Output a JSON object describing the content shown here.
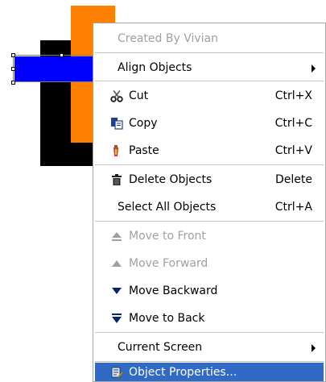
{
  "menu": {
    "items": [
      {
        "label": "Created By Vivian",
        "shortcut": "",
        "icon": "",
        "disabled": true,
        "submenu": false,
        "highlighted": false
      },
      {
        "label": "Align Objects",
        "shortcut": "",
        "icon": "",
        "disabled": false,
        "submenu": true,
        "highlighted": false
      },
      {
        "label": "Cut",
        "shortcut": "Ctrl+X",
        "icon": "scissors-icon",
        "disabled": false,
        "submenu": false,
        "highlighted": false
      },
      {
        "label": "Copy",
        "shortcut": "Ctrl+C",
        "icon": "copy-icon",
        "disabled": false,
        "submenu": false,
        "highlighted": false
      },
      {
        "label": "Paste",
        "shortcut": "Ctrl+V",
        "icon": "paste-icon",
        "disabled": false,
        "submenu": false,
        "highlighted": false
      },
      {
        "label": "Delete Objects",
        "shortcut": "Delete",
        "icon": "trash-icon",
        "disabled": false,
        "submenu": false,
        "highlighted": false
      },
      {
        "label": "Select All Objects",
        "shortcut": "Ctrl+A",
        "icon": "",
        "disabled": false,
        "submenu": false,
        "highlighted": false
      },
      {
        "label": "Move to Front",
        "shortcut": "",
        "icon": "eject-icon",
        "disabled": true,
        "submenu": false,
        "highlighted": false
      },
      {
        "label": "Move Forward",
        "shortcut": "",
        "icon": "triangle-up-icon",
        "disabled": true,
        "submenu": false,
        "highlighted": false
      },
      {
        "label": "Move Backward",
        "shortcut": "",
        "icon": "triangle-down-icon",
        "disabled": false,
        "submenu": false,
        "highlighted": false
      },
      {
        "label": "Move to Back",
        "shortcut": "",
        "icon": "move-to-back-icon",
        "disabled": false,
        "submenu": false,
        "highlighted": false
      },
      {
        "label": "Current Screen",
        "shortcut": "",
        "icon": "",
        "disabled": false,
        "submenu": true,
        "highlighted": false
      },
      {
        "label": "Object Properties...",
        "shortcut": "",
        "icon": "properties-icon",
        "disabled": false,
        "submenu": false,
        "highlighted": true
      }
    ]
  },
  "colors": {
    "highlight": "#316ac5",
    "disabled_text": "#a0a0a0",
    "black_shape": "#000000",
    "orange_shape": "#ff8000",
    "blue_shape": "#0000ff"
  }
}
